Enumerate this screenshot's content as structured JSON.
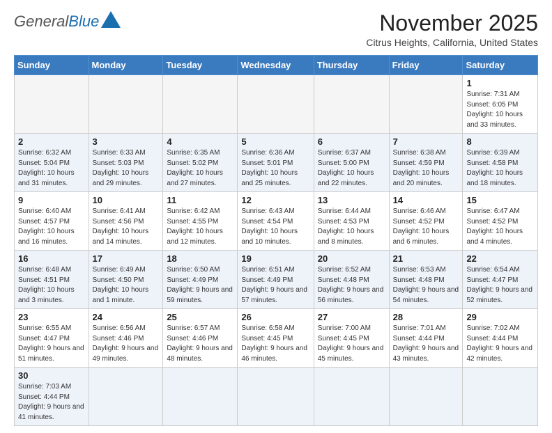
{
  "header": {
    "logo": {
      "general": "General",
      "blue": "Blue"
    },
    "title": "November 2025",
    "location": "Citrus Heights, California, United States"
  },
  "days_of_week": [
    "Sunday",
    "Monday",
    "Tuesday",
    "Wednesday",
    "Thursday",
    "Friday",
    "Saturday"
  ],
  "weeks": [
    [
      {
        "day": "",
        "info": ""
      },
      {
        "day": "",
        "info": ""
      },
      {
        "day": "",
        "info": ""
      },
      {
        "day": "",
        "info": ""
      },
      {
        "day": "",
        "info": ""
      },
      {
        "day": "",
        "info": ""
      },
      {
        "day": "1",
        "info": "Sunrise: 7:31 AM\nSunset: 6:05 PM\nDaylight: 10 hours and 33 minutes."
      }
    ],
    [
      {
        "day": "2",
        "info": "Sunrise: 6:32 AM\nSunset: 5:04 PM\nDaylight: 10 hours and 31 minutes."
      },
      {
        "day": "3",
        "info": "Sunrise: 6:33 AM\nSunset: 5:03 PM\nDaylight: 10 hours and 29 minutes."
      },
      {
        "day": "4",
        "info": "Sunrise: 6:35 AM\nSunset: 5:02 PM\nDaylight: 10 hours and 27 minutes."
      },
      {
        "day": "5",
        "info": "Sunrise: 6:36 AM\nSunset: 5:01 PM\nDaylight: 10 hours and 25 minutes."
      },
      {
        "day": "6",
        "info": "Sunrise: 6:37 AM\nSunset: 5:00 PM\nDaylight: 10 hours and 22 minutes."
      },
      {
        "day": "7",
        "info": "Sunrise: 6:38 AM\nSunset: 4:59 PM\nDaylight: 10 hours and 20 minutes."
      },
      {
        "day": "8",
        "info": "Sunrise: 6:39 AM\nSunset: 4:58 PM\nDaylight: 10 hours and 18 minutes."
      }
    ],
    [
      {
        "day": "9",
        "info": "Sunrise: 6:40 AM\nSunset: 4:57 PM\nDaylight: 10 hours and 16 minutes."
      },
      {
        "day": "10",
        "info": "Sunrise: 6:41 AM\nSunset: 4:56 PM\nDaylight: 10 hours and 14 minutes."
      },
      {
        "day": "11",
        "info": "Sunrise: 6:42 AM\nSunset: 4:55 PM\nDaylight: 10 hours and 12 minutes."
      },
      {
        "day": "12",
        "info": "Sunrise: 6:43 AM\nSunset: 4:54 PM\nDaylight: 10 hours and 10 minutes."
      },
      {
        "day": "13",
        "info": "Sunrise: 6:44 AM\nSunset: 4:53 PM\nDaylight: 10 hours and 8 minutes."
      },
      {
        "day": "14",
        "info": "Sunrise: 6:46 AM\nSunset: 4:52 PM\nDaylight: 10 hours and 6 minutes."
      },
      {
        "day": "15",
        "info": "Sunrise: 6:47 AM\nSunset: 4:52 PM\nDaylight: 10 hours and 4 minutes."
      }
    ],
    [
      {
        "day": "16",
        "info": "Sunrise: 6:48 AM\nSunset: 4:51 PM\nDaylight: 10 hours and 3 minutes."
      },
      {
        "day": "17",
        "info": "Sunrise: 6:49 AM\nSunset: 4:50 PM\nDaylight: 10 hours and 1 minute."
      },
      {
        "day": "18",
        "info": "Sunrise: 6:50 AM\nSunset: 4:49 PM\nDaylight: 9 hours and 59 minutes."
      },
      {
        "day": "19",
        "info": "Sunrise: 6:51 AM\nSunset: 4:49 PM\nDaylight: 9 hours and 57 minutes."
      },
      {
        "day": "20",
        "info": "Sunrise: 6:52 AM\nSunset: 4:48 PM\nDaylight: 9 hours and 56 minutes."
      },
      {
        "day": "21",
        "info": "Sunrise: 6:53 AM\nSunset: 4:48 PM\nDaylight: 9 hours and 54 minutes."
      },
      {
        "day": "22",
        "info": "Sunrise: 6:54 AM\nSunset: 4:47 PM\nDaylight: 9 hours and 52 minutes."
      }
    ],
    [
      {
        "day": "23",
        "info": "Sunrise: 6:55 AM\nSunset: 4:47 PM\nDaylight: 9 hours and 51 minutes."
      },
      {
        "day": "24",
        "info": "Sunrise: 6:56 AM\nSunset: 4:46 PM\nDaylight: 9 hours and 49 minutes."
      },
      {
        "day": "25",
        "info": "Sunrise: 6:57 AM\nSunset: 4:46 PM\nDaylight: 9 hours and 48 minutes."
      },
      {
        "day": "26",
        "info": "Sunrise: 6:58 AM\nSunset: 4:45 PM\nDaylight: 9 hours and 46 minutes."
      },
      {
        "day": "27",
        "info": "Sunrise: 7:00 AM\nSunset: 4:45 PM\nDaylight: 9 hours and 45 minutes."
      },
      {
        "day": "28",
        "info": "Sunrise: 7:01 AM\nSunset: 4:44 PM\nDaylight: 9 hours and 43 minutes."
      },
      {
        "day": "29",
        "info": "Sunrise: 7:02 AM\nSunset: 4:44 PM\nDaylight: 9 hours and 42 minutes."
      }
    ],
    [
      {
        "day": "30",
        "info": "Sunrise: 7:03 AM\nSunset: 4:44 PM\nDaylight: 9 hours and 41 minutes."
      },
      {
        "day": "",
        "info": ""
      },
      {
        "day": "",
        "info": ""
      },
      {
        "day": "",
        "info": ""
      },
      {
        "day": "",
        "info": ""
      },
      {
        "day": "",
        "info": ""
      },
      {
        "day": "",
        "info": ""
      }
    ]
  ]
}
